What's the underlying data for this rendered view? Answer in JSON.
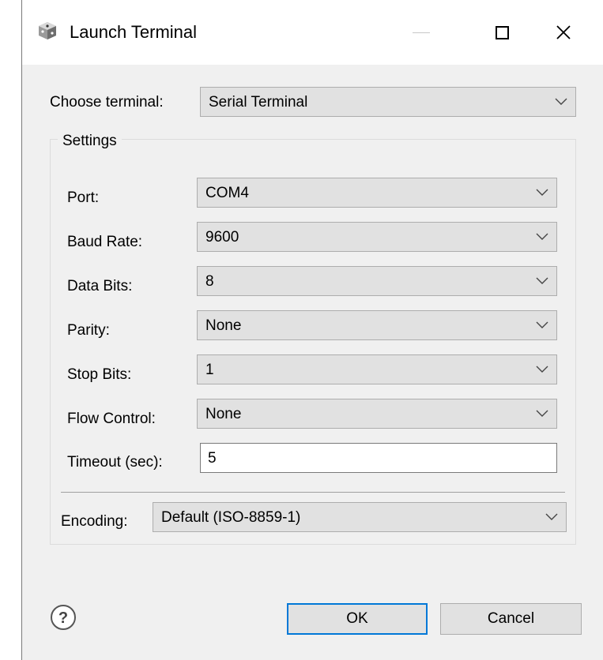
{
  "window": {
    "title": "Launch Terminal",
    "icon": "launch-terminal-icon"
  },
  "choose_terminal": {
    "label": "Choose terminal:",
    "value": "Serial Terminal"
  },
  "settings": {
    "group_title": "Settings",
    "port": {
      "label": "Port:",
      "value": "COM4"
    },
    "baud_rate": {
      "label": "Baud Rate:",
      "value": "9600"
    },
    "data_bits": {
      "label": "Data Bits:",
      "value": "8"
    },
    "parity": {
      "label": "Parity:",
      "value": "None"
    },
    "stop_bits": {
      "label": "Stop Bits:",
      "value": "1"
    },
    "flow_control": {
      "label": "Flow Control:",
      "value": "None"
    },
    "timeout": {
      "label": "Timeout (sec):",
      "value": "5"
    },
    "encoding": {
      "label": "Encoding:",
      "value": "Default (ISO-8859-1)"
    }
  },
  "buttons": {
    "ok": "OK",
    "cancel": "Cancel"
  },
  "colors": {
    "accent": "#0078d7",
    "control_bg": "#e1e1e1",
    "window_bg": "#f0f0f0"
  }
}
